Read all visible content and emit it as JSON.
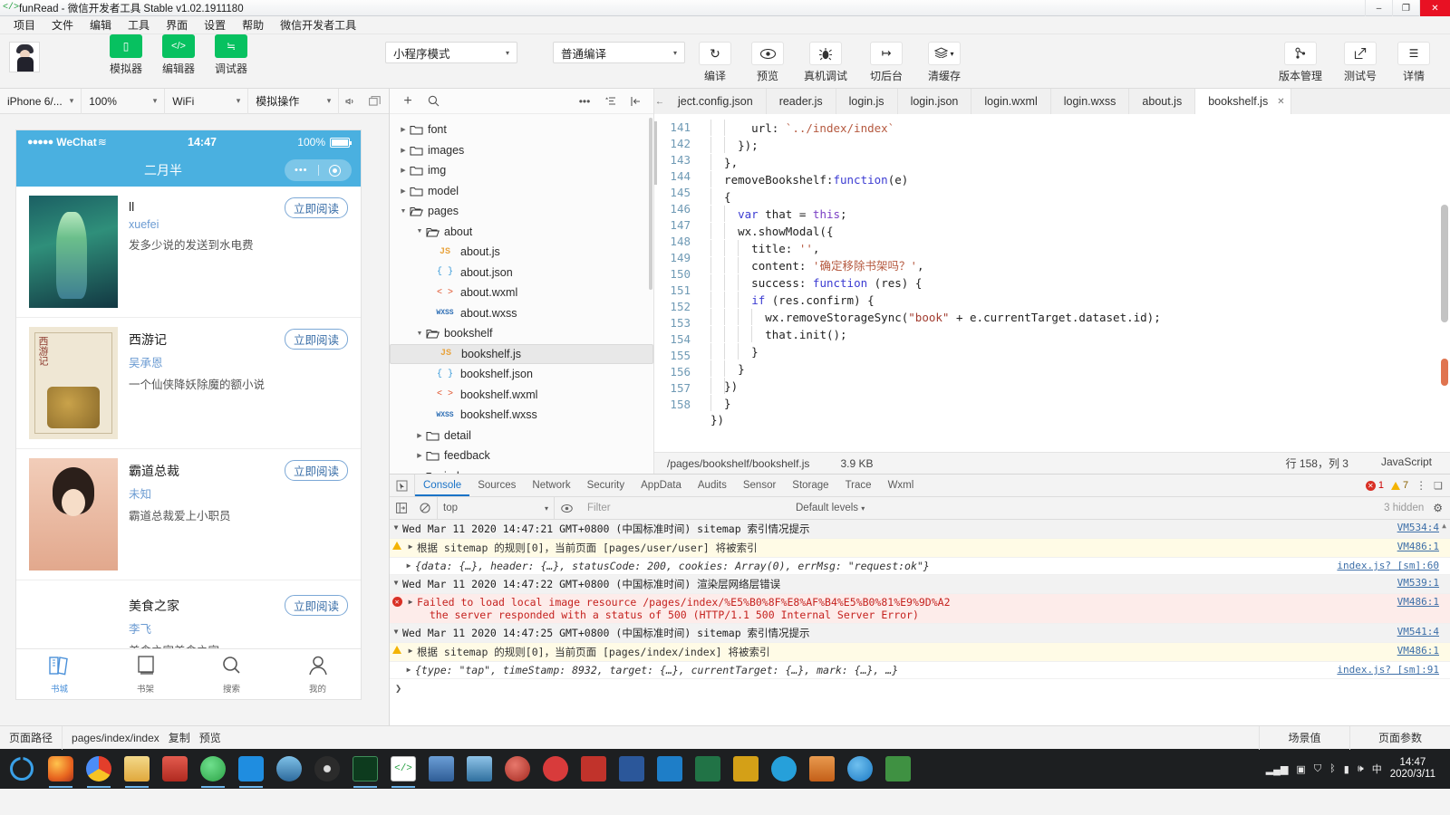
{
  "window": {
    "icon": "code-brackets-icon",
    "title": "funRead - 微信开发者工具 Stable v1.02.1911180",
    "minimize": "–",
    "maximize": "❐",
    "close": "✕"
  },
  "menubar": [
    "项目",
    "文件",
    "编辑",
    "工具",
    "界面",
    "设置",
    "帮助",
    "微信开发者工具"
  ],
  "toolbar": {
    "avatar_name": "user-avatar",
    "left_buttons": [
      {
        "label": "模拟器",
        "icon": "phone-icon",
        "glyph": "▯",
        "style": "green"
      },
      {
        "label": "编辑器",
        "icon": "code-icon",
        "glyph": "</>",
        "style": "green"
      },
      {
        "label": "调试器",
        "icon": "debug-icon",
        "glyph": "≒",
        "style": "green"
      }
    ],
    "mode_select": "小程序模式",
    "compile_select": "普通编译",
    "mid_buttons": [
      {
        "label": "编译",
        "icon": "refresh-icon",
        "glyph": "↻"
      },
      {
        "label": "预览",
        "icon": "eye-icon",
        "glyph": "◉"
      },
      {
        "label": "真机调试",
        "icon": "bug-icon",
        "glyph": "🐞"
      },
      {
        "label": "切后台",
        "icon": "switch-background-icon",
        "glyph": "↦"
      },
      {
        "label": "清缓存",
        "icon": "layers-icon",
        "glyph": "≋",
        "caret": "▾"
      }
    ],
    "right_buttons": [
      {
        "label": "版本管理",
        "icon": "branch-icon",
        "glyph": "ᛘ"
      },
      {
        "label": "测试号",
        "icon": "external-link-icon",
        "glyph": "↗"
      },
      {
        "label": "详情",
        "icon": "hamburger-icon",
        "glyph": "☰"
      }
    ]
  },
  "simulator": {
    "controls": [
      {
        "name": "device-select",
        "value": "iPhone 6/..."
      },
      {
        "name": "zoom-select",
        "value": "100%"
      },
      {
        "name": "network-select",
        "value": "WiFi"
      },
      {
        "name": "gesture-select",
        "value": "模拟操作"
      }
    ],
    "icons": [
      {
        "name": "mute-icon",
        "glyph": "🕨"
      },
      {
        "name": "detach-window-icon",
        "glyph": "❏"
      }
    ],
    "phone": {
      "carrier": "WeChat",
      "carrier_dots": "●●●●●",
      "wifi_glyph": "≋",
      "time": "14:47",
      "battery_text": "100%",
      "nav_title": "二月半",
      "nav_dots": "•••",
      "nav_target_icon": "target-icon",
      "read_button": "立即阅读",
      "books": [
        {
          "title": "ll",
          "author": "xuefei",
          "desc": "发多少说的发送到水电费",
          "cover": "cv1"
        },
        {
          "title": "西游记",
          "author": "吴承恩",
          "desc": "一个仙侠降妖除魔的额小说",
          "cover": "cv2"
        },
        {
          "title": "霸道总裁",
          "author": "未知",
          "desc": "霸道总裁爱上小职员",
          "cover": "cv3"
        },
        {
          "title": "美食之家",
          "author": "李飞",
          "desc": "美食之家美食之家",
          "cover": "none"
        }
      ],
      "tabs": [
        {
          "label": "书城",
          "icon": "bookstore-icon",
          "active": true
        },
        {
          "label": "书架",
          "icon": "bookshelf-icon",
          "active": false
        },
        {
          "label": "搜索",
          "icon": "search-icon",
          "active": false
        },
        {
          "label": "我的",
          "icon": "profile-icon",
          "active": false
        }
      ]
    }
  },
  "filetree": {
    "toolbar_icons": [
      {
        "name": "add-file-icon",
        "glyph": "+"
      },
      {
        "name": "search-icon",
        "glyph": "⌕"
      },
      {
        "name": "more-icon",
        "glyph": "•••"
      },
      {
        "name": "sort-icon",
        "glyph": "≞"
      },
      {
        "name": "collapse-icon",
        "glyph": "⍄"
      }
    ],
    "nodes": [
      {
        "label": "font",
        "type": "folder",
        "depth": 0,
        "open": false
      },
      {
        "label": "images",
        "type": "folder",
        "depth": 0,
        "open": false
      },
      {
        "label": "img",
        "type": "folder",
        "depth": 0,
        "open": false
      },
      {
        "label": "model",
        "type": "folder",
        "depth": 0,
        "open": false
      },
      {
        "label": "pages",
        "type": "folder",
        "depth": 0,
        "open": true
      },
      {
        "label": "about",
        "type": "folder",
        "depth": 1,
        "open": true
      },
      {
        "label": "about.js",
        "type": "js",
        "depth": 2
      },
      {
        "label": "about.json",
        "type": "json",
        "depth": 2
      },
      {
        "label": "about.wxml",
        "type": "wxml",
        "depth": 2
      },
      {
        "label": "about.wxss",
        "type": "wxss",
        "depth": 2
      },
      {
        "label": "bookshelf",
        "type": "folder",
        "depth": 1,
        "open": true
      },
      {
        "label": "bookshelf.js",
        "type": "js",
        "depth": 2,
        "selected": true
      },
      {
        "label": "bookshelf.json",
        "type": "json",
        "depth": 2
      },
      {
        "label": "bookshelf.wxml",
        "type": "wxml",
        "depth": 2
      },
      {
        "label": "bookshelf.wxss",
        "type": "wxss",
        "depth": 2
      },
      {
        "label": "detail",
        "type": "folder",
        "depth": 1,
        "open": false
      },
      {
        "label": "feedback",
        "type": "folder",
        "depth": 1,
        "open": false
      },
      {
        "label": "index",
        "type": "folder",
        "depth": 1,
        "open": false
      }
    ]
  },
  "editor": {
    "back_arrow": "←",
    "tabs": [
      {
        "label": "ject.config.json",
        "active": false
      },
      {
        "label": "reader.js",
        "active": false
      },
      {
        "label": "login.js",
        "active": false
      },
      {
        "label": "login.json",
        "active": false
      },
      {
        "label": "login.wxml",
        "active": false
      },
      {
        "label": "login.wxss",
        "active": false
      },
      {
        "label": "about.js",
        "active": false
      },
      {
        "label": "bookshelf.js",
        "active": true
      }
    ],
    "first_line_number": 141,
    "lines": [
      "        url: `../index/index`",
      "      });",
      "    },",
      "    removeBookshelf:function(e)",
      "    {",
      "      var that = this;",
      "      wx.showModal({",
      "        title: '',",
      "        content: '确定移除书架吗？',",
      "        success: function (res) {",
      "          if (res.confirm) {",
      "            wx.removeStorageSync(\"book\" + e.currentTarget.dataset.id);",
      "            that.init();",
      "          }",
      "        }",
      "      })",
      "    }",
      "})"
    ],
    "status": {
      "path": "/pages/bookshelf/bookshelf.js",
      "size": "3.9 KB",
      "cursor": "行 158，列 3",
      "language": "JavaScript"
    }
  },
  "devtools": {
    "inspect_icon": "inspect-cursor-icon",
    "tabs": [
      "Console",
      "Sources",
      "Network",
      "Security",
      "AppData",
      "Audits",
      "Sensor",
      "Storage",
      "Trace",
      "Wxml"
    ],
    "active_tab": "Console",
    "error_count": "1",
    "warning_count": "7",
    "kebab_icon": "more-vertical-icon",
    "dock_icon": "dock-panel-icon",
    "filterbar": {
      "sidebar_icon": "sidebar-toggle-icon",
      "clear_icon": "clear-console-icon",
      "context": "top",
      "eye_icon": "live-expression-icon",
      "filter_placeholder": "Filter",
      "levels": "Default levels",
      "hidden_text": "3 hidden",
      "settings_icon": "gear-icon"
    },
    "messages": [
      {
        "kind": "group",
        "text": "Wed Mar 11 2020 14:47:21 GMT+0800 (中国标准时间) sitemap 索引情况提示",
        "src": "VM534:4"
      },
      {
        "kind": "warn",
        "text": "根据 sitemap 的规则[0]，当前页面 [pages/user/user] 将被索引",
        "src": "VM486:1"
      },
      {
        "kind": "log",
        "text": "{data: {…}, header: {…}, statusCode: 200, cookies: Array(0), errMsg: \"request:ok\"}",
        "src": "index.js? [sm]:60"
      },
      {
        "kind": "group",
        "text": "Wed Mar 11 2020 14:47:22 GMT+0800 (中国标准时间) 渲染层网络层错误",
        "src": "VM539:1"
      },
      {
        "kind": "error",
        "text": "Failed to load local image resource /pages/index/%E5%B0%8F%E8%AF%B4%E5%B0%81%E9%9D%A2\n  the server responded with a status of 500 (HTTP/1.1 500 Internal Server Error)",
        "src": "VM486:1"
      },
      {
        "kind": "group",
        "text": "Wed Mar 11 2020 14:47:25 GMT+0800 (中国标准时间) sitemap 索引情况提示",
        "src": "VM541:4"
      },
      {
        "kind": "warn",
        "text": "根据 sitemap 的规则[0]，当前页面 [pages/index/index] 将被索引",
        "src": "VM486:1"
      },
      {
        "kind": "log",
        "text": "{type: \"tap\", timeStamp: 8932, target: {…}, currentTarget: {…}, mark: {…}, …}",
        "src": "index.js? [sm]:91"
      }
    ],
    "prompt_glyph": "❯"
  },
  "bottombar": {
    "label_path": "页面路径",
    "page_path": "pages/index/index",
    "copy": "复制",
    "preview": "预览",
    "scene_value": "场景值",
    "page_params": "页面参数"
  },
  "taskbar": {
    "start_icon": "windows-start-icon",
    "items": [
      {
        "name": "firefox-icon",
        "color": "#e8651f"
      },
      {
        "name": "chrome-icon",
        "color": "#4b8df8"
      },
      {
        "name": "file-explorer-icon",
        "color": "#e9c05a"
      },
      {
        "name": "video-player-icon",
        "color": "#c4352c"
      },
      {
        "name": "wechat-icon",
        "color": "#2ba245"
      },
      {
        "name": "u-app-icon",
        "color": "#1f8de0"
      },
      {
        "name": "photos-icon",
        "color": "#3c7fb1"
      },
      {
        "name": "dvd-icon",
        "color": "#2b2b2b"
      },
      {
        "name": "terminal-icon",
        "color": "#1f7a3f"
      },
      {
        "name": "devtools-icon",
        "color": "#6f6f6f"
      },
      {
        "name": "java-icon",
        "color": "#3b6eb4"
      },
      {
        "name": "vm-icon",
        "color": "#3a7dbd"
      },
      {
        "name": "browser2-icon",
        "color": "#b2342b"
      },
      {
        "name": "music-icon",
        "color": "#d83b3b"
      },
      {
        "name": "pdf-icon",
        "color": "#c1332b"
      },
      {
        "name": "word-icon",
        "color": "#2b579a"
      },
      {
        "name": "mail-icon",
        "color": "#1e7ec8"
      },
      {
        "name": "excel-icon",
        "color": "#217346"
      },
      {
        "name": "notes-icon",
        "color": "#d4a017"
      },
      {
        "name": "chat-icon",
        "color": "#26a0da"
      },
      {
        "name": "paint-icon",
        "color": "#c45f18"
      },
      {
        "name": "ie-icon",
        "color": "#1b79c4"
      },
      {
        "name": "calc-icon",
        "color": "#3f9142"
      }
    ],
    "tray": [
      {
        "name": "signal-icon",
        "glyph": "▂▄▆"
      },
      {
        "name": "network-icon",
        "glyph": "▣"
      },
      {
        "name": "shield-icon",
        "glyph": "⛉"
      },
      {
        "name": "bluetooth-icon",
        "glyph": "ᛒ"
      },
      {
        "name": "battery-icon",
        "glyph": "▮"
      },
      {
        "name": "volume-icon",
        "glyph": "🕪"
      },
      {
        "name": "input-icon",
        "glyph": "中"
      }
    ],
    "clock_time": "14:47",
    "clock_date": "2020/3/11"
  }
}
